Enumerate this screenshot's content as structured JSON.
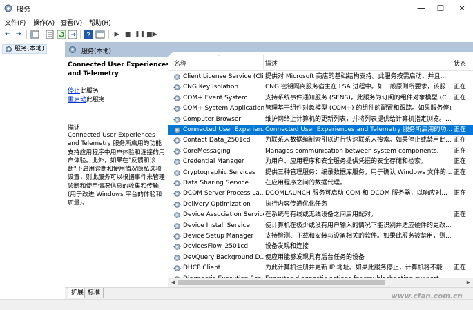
{
  "window": {
    "title": "服务"
  },
  "menu": [
    "文件(F)",
    "操作(A)",
    "查看(V)",
    "帮助(H)"
  ],
  "toolbar": {
    "icons": [
      "back-arrow-icon",
      "forward-arrow-icon",
      "up-folder-icon",
      "show-hide-tree-icon",
      "properties-icon",
      "refresh-icon",
      "export-list-icon",
      "help-icon",
      "console-icon",
      "play-icon",
      "stop-icon",
      "pause-icon",
      "restart-icon"
    ]
  },
  "tree": {
    "selected": "服务(本地)"
  },
  "header": {
    "title": "服务(本地)"
  },
  "desc": {
    "service_title": "Connected User Experiences and Telemetry",
    "stop_link": "停止",
    "stop_suffix": "此服务",
    "restart_link": "重启动",
    "restart_suffix": "此服务",
    "desc_label": "描述:",
    "desc_text": "Connected User Experiences and Telemetry 服务所启用的功能支持应用程序中用户体验和连接的用户体验。此外，如果在\"反馈和诊断\"下启用诊断和使用情况隐私选项设置，则此服务可以根据事件来管理诊断和使用情况信息的收集和传输(用于改进 Windows 平台的体验和质量)。"
  },
  "columns": {
    "name": "名称",
    "description": "描述",
    "status": "状态"
  },
  "services": [
    {
      "name": "Client License Service (Cli...",
      "desc": "提供对 Microsoft 商店的基础结构支持。此服务按需启动，并且...",
      "status": ""
    },
    {
      "name": "CNG Key Isolation",
      "desc": "CNG 密钥隔离服务宿主在 LSA 进程中。如一般原则所要求，该服...",
      "status": "正在"
    },
    {
      "name": "COM+ Event System",
      "desc": "支持系统事件通知服务 (SENS)，此服务为订阅的组件对象模型 (C...",
      "status": "正在"
    },
    {
      "name": "COM+ System Application",
      "desc": "管理基于组件对象模型 (COM+) 的组件的配置和跟踪。如果服务停止...",
      "status": ""
    },
    {
      "name": "Computer Browser",
      "desc": "维护网络上计算机的更新列表，并将列表提供给计算机指定浏览。...",
      "status": ""
    },
    {
      "name": "Connected User Experien...",
      "desc": "Connected User Experiences and Telemetry 服务所启用的功...",
      "status": "正在",
      "selected": true
    },
    {
      "name": "Contact Data_2501cd",
      "desc": "为联系人数据编制索引以进行快速联系人搜索。如果停止或禁用此...",
      "status": "正在"
    },
    {
      "name": "CoreMessaging",
      "desc": "Manages communication between system components.",
      "status": "正在"
    },
    {
      "name": "Credential Manager",
      "desc": "为用户、应用程序和安全服务提供凭据的安全存储和检索。",
      "status": "正在"
    },
    {
      "name": "Cryptographic Services",
      "desc": "提供三种管理服务：编录数据库服务，用于确认 Windows 文件的...",
      "status": "正在"
    },
    {
      "name": "Data Sharing Service",
      "desc": "在应用程序之间的数据代理。",
      "status": ""
    },
    {
      "name": "DCOM Server Process La...",
      "desc": "DCOMLAUNCH 服务可启动 COM 和 DCOM 服务器，以响应对...",
      "status": "正在"
    },
    {
      "name": "Delivery Optimization",
      "desc": "执行内容传递优化任务",
      "status": ""
    },
    {
      "name": "Device Association Service",
      "desc": "在系统与有线或无线设备之间启用配对。",
      "status": "正在"
    },
    {
      "name": "Device Install Service",
      "desc": "使计算机在极少或没有用户输入的情况下能识别并适应硬件的更改...",
      "status": ""
    },
    {
      "name": "Device Setup Manager",
      "desc": "支持检测、下载和安装与设备相关的软件。如果此服务被禁用，则...",
      "status": ""
    },
    {
      "name": "DevicesFlow_2501cd",
      "desc": "设备发现和连接",
      "status": ""
    },
    {
      "name": "DevQuery Background D...",
      "desc": "使应用能够发现具有后台任务的设备",
      "status": ""
    },
    {
      "name": "DHCP Client",
      "desc": "为此计算机注册并更新 IP 地址。如果此服务停止，计算机将不能...",
      "status": "正在"
    },
    {
      "name": "Diagnostic Execution Ser...",
      "desc": "Executes diagnostic actions for troubleshooting support",
      "status": ""
    }
  ],
  "tabs": [
    "扩展",
    "标准"
  ],
  "watermark": "www.cfan.com.cn"
}
